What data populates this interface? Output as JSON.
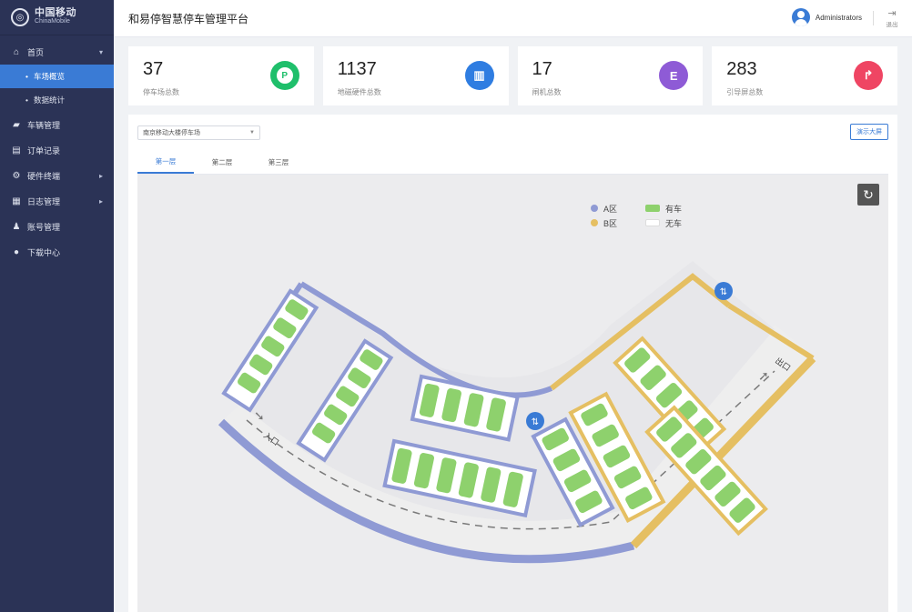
{
  "sidebar": {
    "logo": {
      "cn": "中国移动",
      "en": "ChinaMobile"
    },
    "items": [
      {
        "label": "首页",
        "icon": "home-icon",
        "glyph": "⌂",
        "arrow": "▾"
      },
      {
        "label": "车辆管理",
        "icon": "car-icon",
        "glyph": "🚗",
        "arrow": ""
      },
      {
        "label": "订单记录",
        "icon": "document-icon",
        "glyph": "▤",
        "arrow": ""
      },
      {
        "label": "硬件终端",
        "icon": "gear-icon",
        "glyph": "⚙",
        "arrow": "▸"
      },
      {
        "label": "日志管理",
        "icon": "log-icon",
        "glyph": "▦",
        "arrow": "▸"
      },
      {
        "label": "账号管理",
        "icon": "user-icon",
        "glyph": "♟",
        "arrow": ""
      },
      {
        "label": "下载中心",
        "icon": "download-icon",
        "glyph": "●",
        "arrow": ""
      }
    ],
    "sub_items": [
      "车场概览",
      "数据统计"
    ]
  },
  "header": {
    "title": "和易停智慧停车管理平台",
    "user": "Administrators",
    "logout": "退出"
  },
  "stats": [
    {
      "value": "37",
      "label": "停车场总数",
      "icon": "parking-icon",
      "glyph": "P",
      "color": "#1fbf6b"
    },
    {
      "value": "1137",
      "label": "地磁硬件总数",
      "icon": "sensor-icon",
      "glyph": "▥",
      "color": "#2f7de1"
    },
    {
      "value": "17",
      "label": "闸机总数",
      "icon": "gate-icon",
      "glyph": "E",
      "color": "#8e5bd6"
    },
    {
      "value": "283",
      "label": "引导屏总数",
      "icon": "guide-screen-icon",
      "glyph": "↱",
      "color": "#ef4563"
    }
  ],
  "panel": {
    "select_value": "南京移动大楼停车场",
    "screen_button": "演示大屏",
    "tabs": [
      "第一层",
      "第二层",
      "第三层"
    ]
  },
  "map": {
    "legend": {
      "zone_a": "A区",
      "zone_b": "B区",
      "occupied": "有车",
      "empty": "无车"
    },
    "entrance_label": "入口",
    "exit_label": "出口",
    "colors": {
      "zone_a": "#8f9ad4",
      "zone_b": "#e5bf62",
      "car": "#8ed16d",
      "road": "#eeeeee"
    }
  }
}
